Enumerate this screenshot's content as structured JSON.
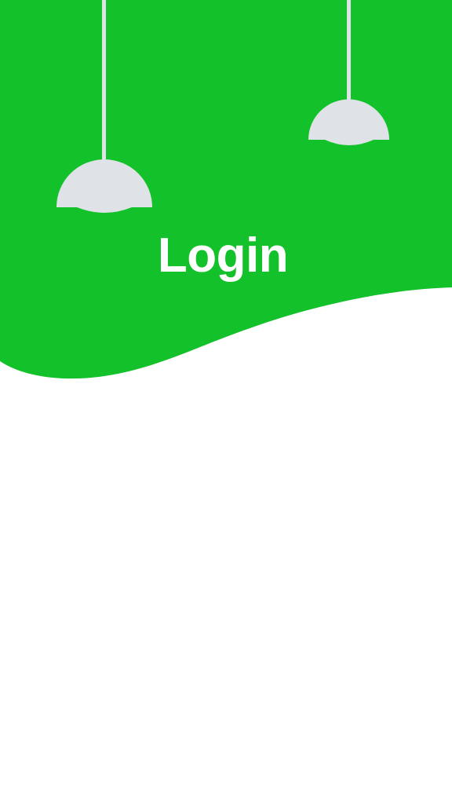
{
  "header": {
    "title": "Login"
  },
  "icons": {
    "left_lamp": "pendant-lamp-icon",
    "right_lamp": "pendant-lamp-icon"
  },
  "colors": {
    "brand_green": "#13c12b",
    "lamp_shade": "#dfe3e8",
    "lamp_cord": "#dfe3e8",
    "background": "#ffffff",
    "title_text": "#ffffff"
  }
}
